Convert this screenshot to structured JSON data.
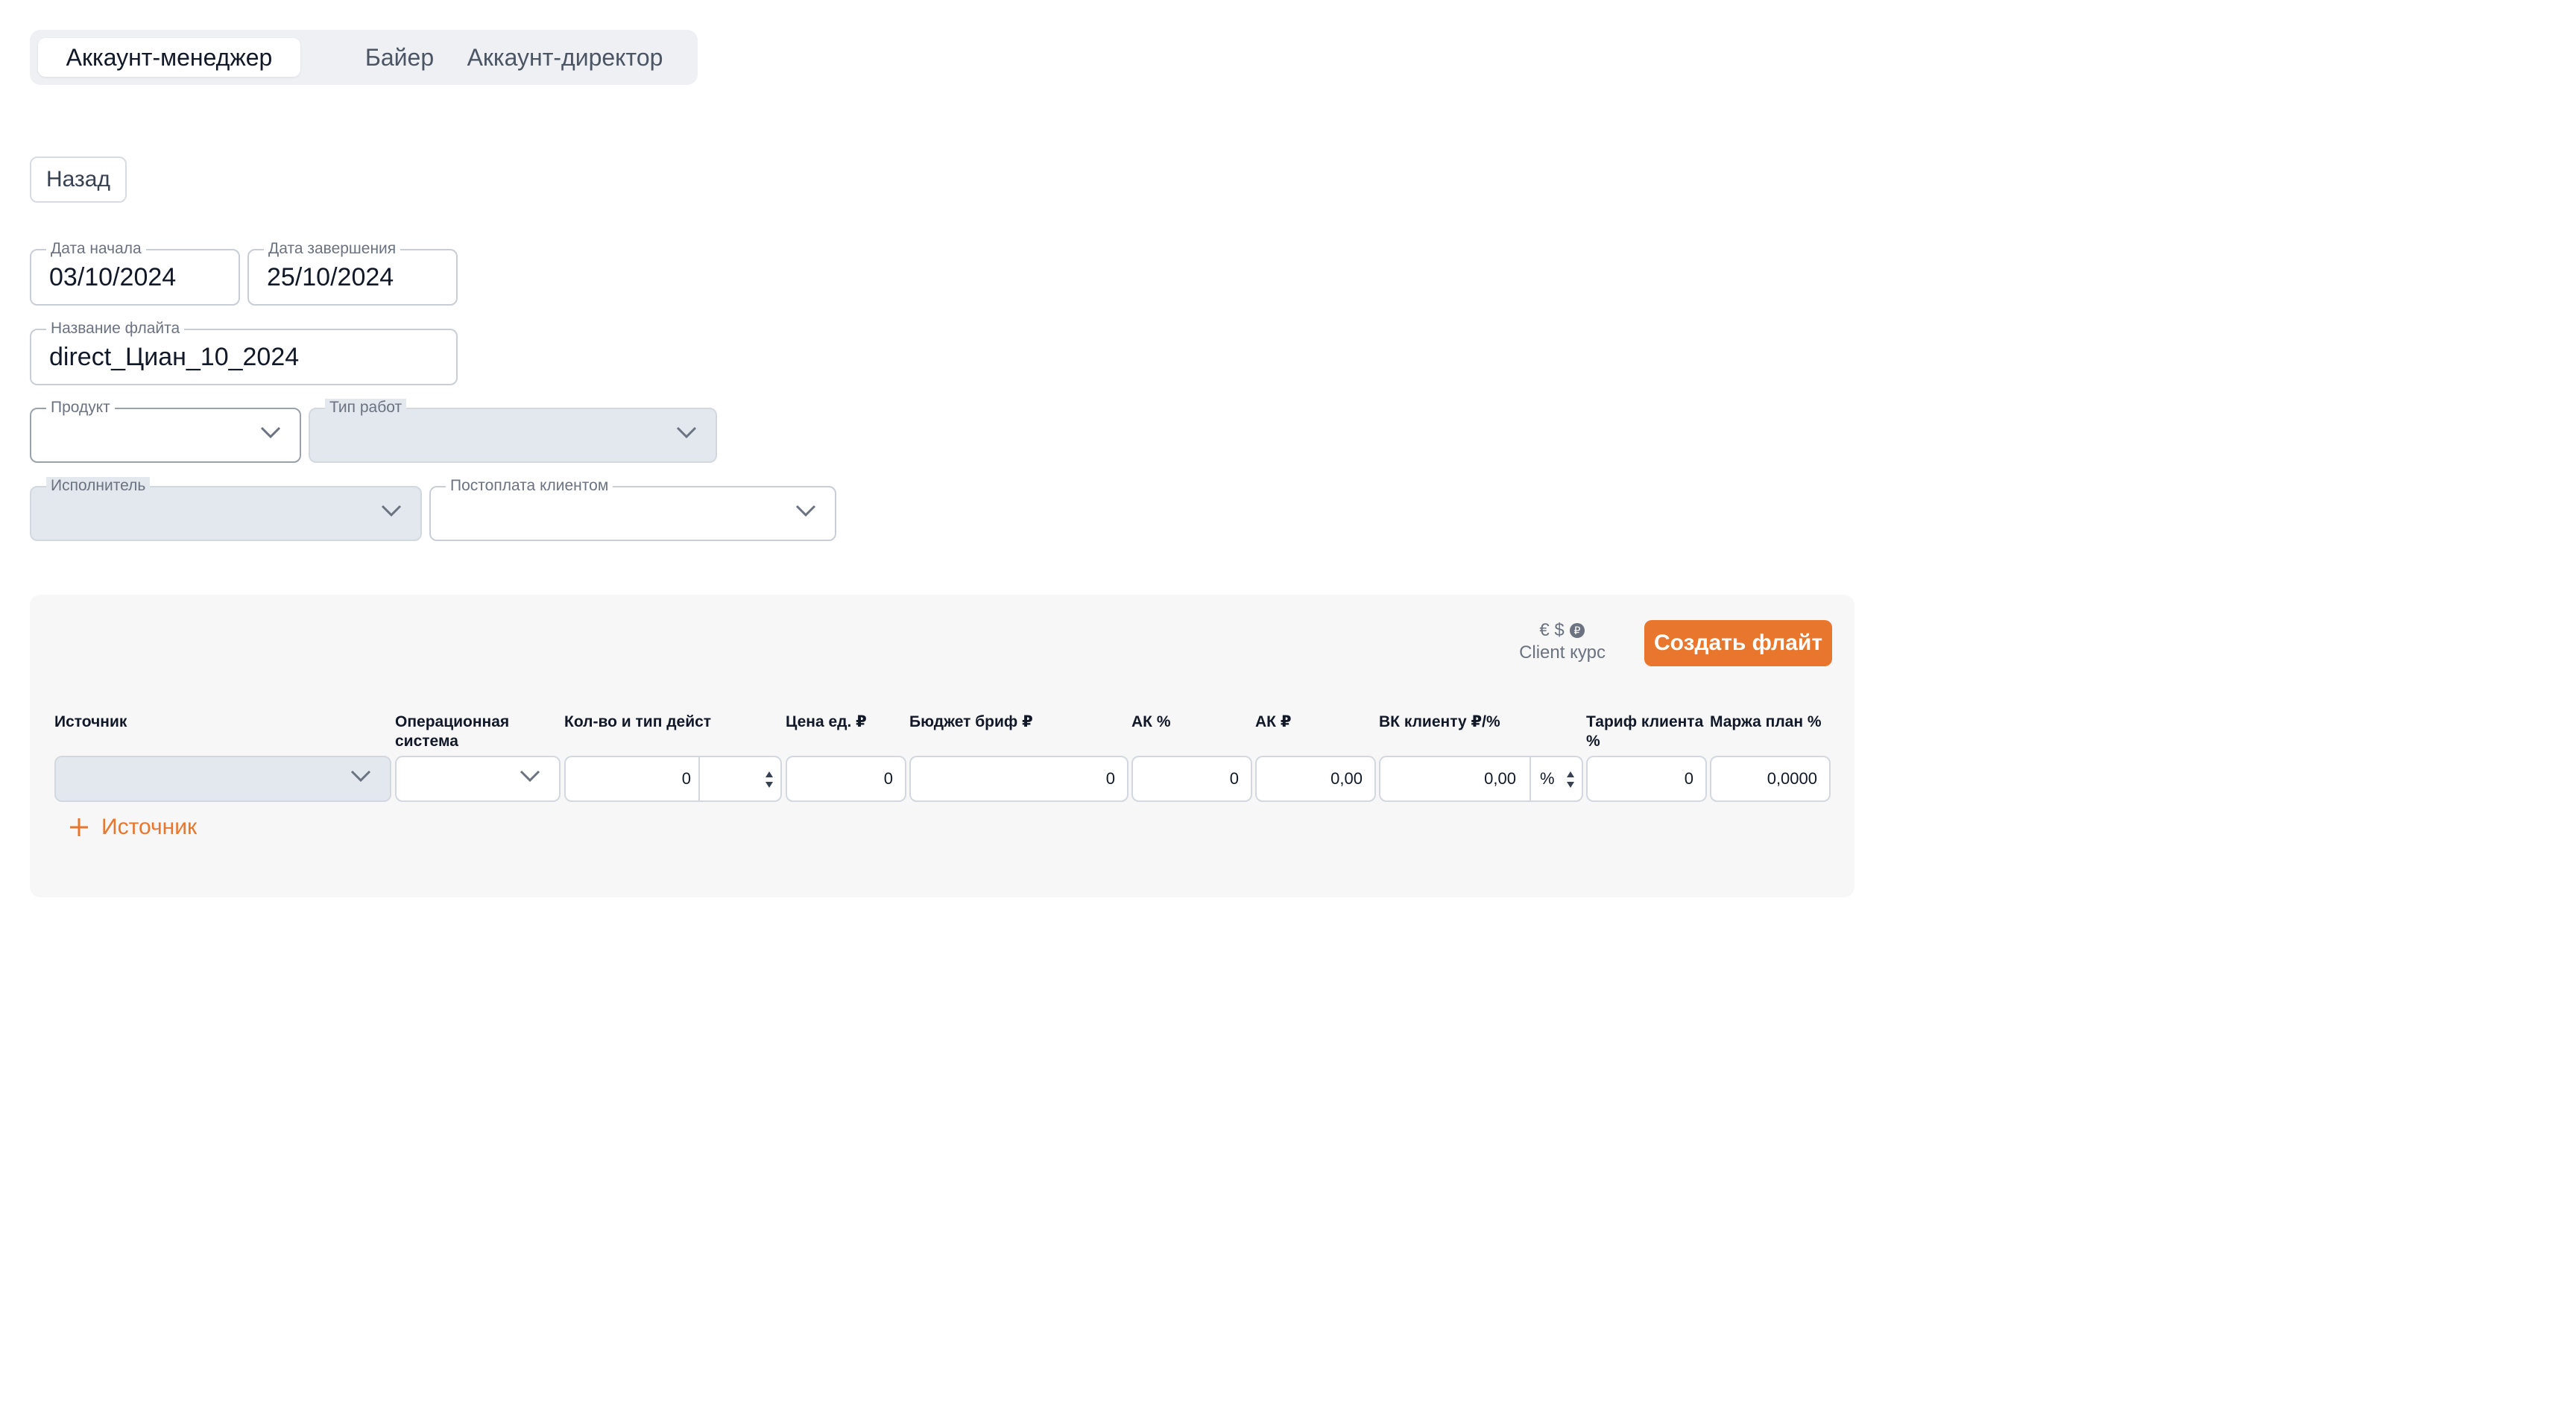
{
  "tabs": [
    {
      "label": "Аккаунт-менеджер",
      "active": true
    },
    {
      "label": "Байер",
      "active": false
    },
    {
      "label": "Аккаунт-директор",
      "active": false
    }
  ],
  "back_label": "Назад",
  "form": {
    "start_date": {
      "label": "Дата начала",
      "value": "03/10/2024"
    },
    "end_date": {
      "label": "Дата завершения",
      "value": "25/10/2024"
    },
    "flight_name": {
      "label": "Название флайта",
      "value": "direct_Циан_10_2024"
    },
    "product": {
      "label": "Продукт",
      "value": ""
    },
    "work_type": {
      "label": "Тип работ",
      "value": ""
    },
    "executor": {
      "label": "Исполнитель",
      "value": ""
    },
    "postpayment": {
      "label": "Постоплата клиентом",
      "value": ""
    }
  },
  "panel": {
    "currency_symbols": "€ $",
    "currency_icons": [
      "euro-icon",
      "dollar-icon",
      "info-icon"
    ],
    "client_rate_label": "Client курс",
    "create_label": "Создать флайт",
    "add_source_label": "Источник",
    "columns": {
      "source": "Источник",
      "os": "Операционная система",
      "qty": "Кол-во и тип дейст",
      "unit_price": "Цена ед. ₽",
      "budget": "Бюджет бриф ₽",
      "ak_pct": "АК %",
      "ak_rub": "АК ₽",
      "vk": "ВК клиенту ₽/%",
      "tariff": "Тариф клиента %",
      "margin": "Маржа план %"
    },
    "row": {
      "qty": "0",
      "unit_price": "0",
      "budget": "0",
      "ak_pct": "0",
      "ak_rub": "0,00",
      "vk_value": "0,00",
      "vk_unit": "%",
      "tariff": "0",
      "margin": "0,0000"
    }
  },
  "colors": {
    "accent": "#e8762d",
    "disabled_field": "#e3e7ee",
    "panel_bg": "#f7f7f8"
  }
}
